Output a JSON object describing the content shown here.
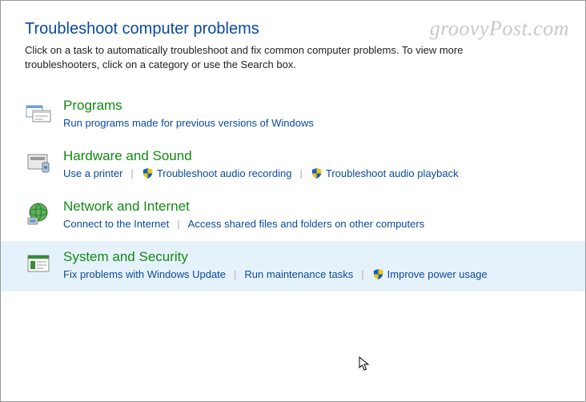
{
  "watermark": "groovyPost.com",
  "header": {
    "title": "Troubleshoot computer problems",
    "description": "Click on a task to automatically troubleshoot and fix common computer problems. To view more troubleshooters, click on a category or use the Search box."
  },
  "categories": [
    {
      "id": "programs",
      "title": "Programs",
      "selected": false,
      "links": [
        {
          "label": "Run programs made for previous versions of Windows",
          "shield": false
        }
      ]
    },
    {
      "id": "hardware-sound",
      "title": "Hardware and Sound",
      "selected": false,
      "links": [
        {
          "label": "Use a printer",
          "shield": false
        },
        {
          "label": "Troubleshoot audio recording",
          "shield": true
        },
        {
          "label": "Troubleshoot audio playback",
          "shield": true
        }
      ]
    },
    {
      "id": "network-internet",
      "title": "Network and Internet",
      "selected": false,
      "links": [
        {
          "label": "Connect to the Internet",
          "shield": false
        },
        {
          "label": "Access shared files and folders on other computers",
          "shield": false
        }
      ]
    },
    {
      "id": "system-security",
      "title": "System and Security",
      "selected": true,
      "links": [
        {
          "label": "Fix problems with Windows Update",
          "shield": false
        },
        {
          "label": "Run maintenance tasks",
          "shield": false
        },
        {
          "label": "Improve power usage",
          "shield": true
        }
      ]
    }
  ]
}
